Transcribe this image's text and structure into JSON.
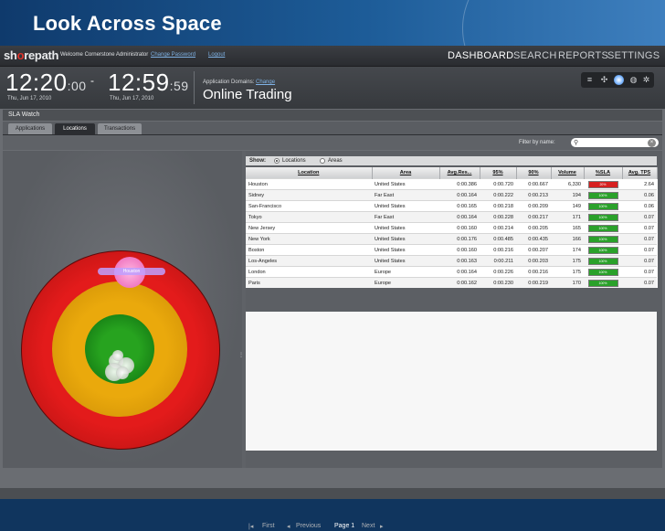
{
  "banner": {
    "title": "Look Across Space"
  },
  "header": {
    "logo": "shorepath",
    "welcome": "Welcome Cornerstone Administrator",
    "change_password": "Change Password",
    "logout": "Logout",
    "nav": [
      "DASHBOARD",
      "SEARCH",
      "REPORTS",
      "SETTINGS"
    ],
    "active_nav": "DASHBOARD"
  },
  "clock": {
    "start_time": "12:20",
    "start_sec": ":00",
    "start_date": "Thu, Jun 17, 2010",
    "dash": "-",
    "end_time": "12:59",
    "end_sec": ":59",
    "end_date": "Thu, Jun 17, 2010"
  },
  "domains": {
    "label": "Application Domains:",
    "change": "Change",
    "name": "Online Trading"
  },
  "view_icons": [
    "list-icon",
    "network-icon",
    "globe-icon-active",
    "globe-icon",
    "settings-icon"
  ],
  "sla": {
    "title": "SLA Watch",
    "tabs": [
      "Applications",
      "Locations",
      "Transactions"
    ],
    "active_tab": "Locations",
    "filter_label": "Filter by name:",
    "filter_value": ""
  },
  "map": {
    "pin_label": "Houston"
  },
  "table": {
    "show_label": "Show:",
    "show_options": [
      "Locations",
      "Areas"
    ],
    "show_selected": "Locations",
    "columns": [
      "Location",
      "Area",
      "Avg.Res...",
      "95%",
      "90%",
      "Volume",
      "%SLA",
      "Avg. TPS"
    ],
    "rows": [
      [
        "Houston",
        "United States",
        "0:00.386",
        "0:00.720",
        "0:00.667",
        "6,330",
        "20%",
        "2.64"
      ],
      [
        "Sidney",
        "Far East",
        "0:00.164",
        "0:00.222",
        "0:00.213",
        "194",
        "100%",
        "0.06"
      ],
      [
        "San-Francisco",
        "United States",
        "0:00.165",
        "0:00.218",
        "0:00.209",
        "149",
        "100%",
        "0.06"
      ],
      [
        "Tokyo",
        "Far East",
        "0:00.164",
        "0:00.228",
        "0:00.217",
        "171",
        "100%",
        "0.07"
      ],
      [
        "New Jersey",
        "United States",
        "0:00.160",
        "0:00.214",
        "0:00.205",
        "165",
        "100%",
        "0.07"
      ],
      [
        "New York",
        "United States",
        "0:00.176",
        "0:00.485",
        "0:00.435",
        "166",
        "100%",
        "0.07"
      ],
      [
        "Boston",
        "United States",
        "0:00.160",
        "0:00.216",
        "0:00.207",
        "174",
        "100%",
        "0.07"
      ],
      [
        "Los-Angeles",
        "United States",
        "0:00.163",
        "0:00.211",
        "0:00.203",
        "175",
        "100%",
        "0.07"
      ],
      [
        "London",
        "Europe",
        "0:00.164",
        "0:00.226",
        "0:00.216",
        "175",
        "100%",
        "0.07"
      ],
      [
        "Paris",
        "Europe",
        "0:00.162",
        "0:00.230",
        "0:00.219",
        "170",
        "100%",
        "0.07"
      ]
    ],
    "sla_status_colors": [
      "#d62020",
      "#2aa12a",
      "#2aa12a",
      "#2aa12a",
      "#2aa12a",
      "#2aa12a",
      "#2aa12a",
      "#2aa12a",
      "#2aa12a",
      "#2aa12a"
    ]
  },
  "pager": {
    "first": "First",
    "previous": "Previous",
    "page": "Page 1",
    "next": "Next"
  },
  "colors": {
    "critical": "#e31b1b",
    "warning": "#eaa90c",
    "ok": "#27a31f",
    "banner": "#1d5c98"
  }
}
